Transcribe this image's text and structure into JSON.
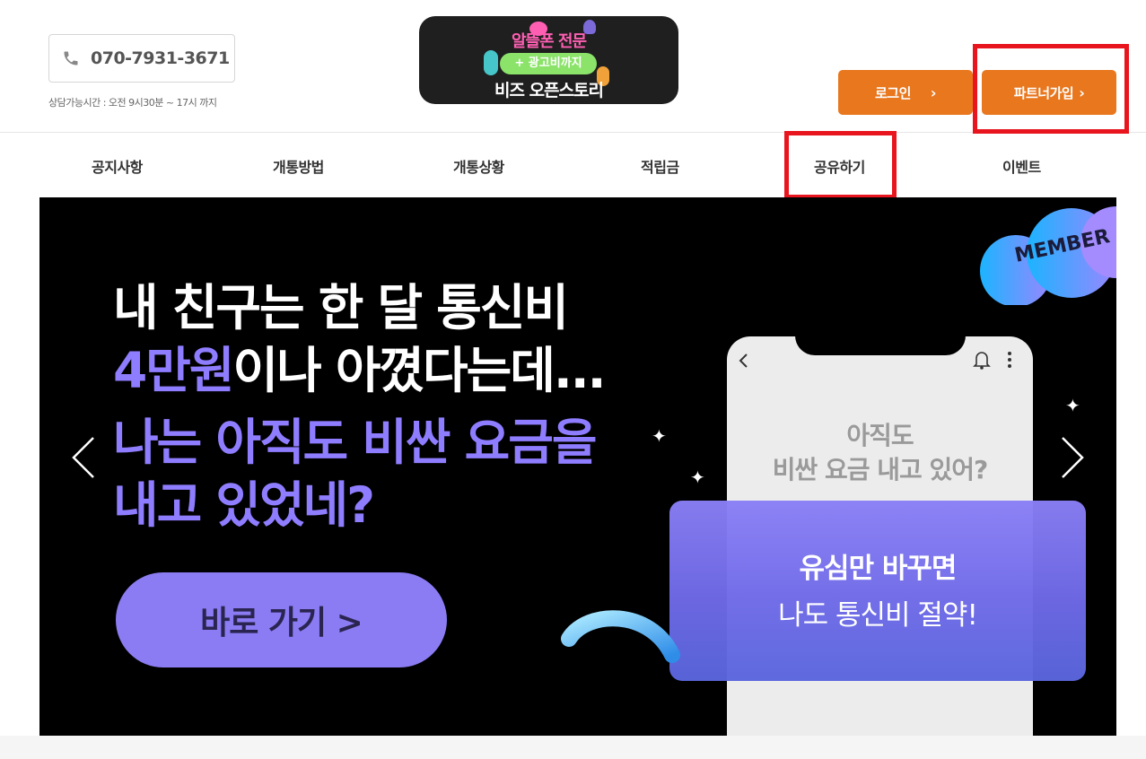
{
  "header": {
    "phone_number": "070-7931-3671",
    "hours": "상담가능시간 : 오전 9시30분 ~ 17시 까지",
    "logo": {
      "line1": "알뜰폰 전문",
      "line2": "+ 광고비까지",
      "line3": "비즈 오픈스토리"
    },
    "login_label": "로그인",
    "partner_label": "파트너가입",
    "chevron": "›"
  },
  "nav": {
    "items": [
      {
        "label": "공지사항"
      },
      {
        "label": "개통방법"
      },
      {
        "label": "개통상황"
      },
      {
        "label": "적립금"
      },
      {
        "label": "공유하기"
      },
      {
        "label": "이벤트"
      }
    ]
  },
  "banner": {
    "line1": "내 친구는 한 달 통신비",
    "line2_highlight": "4만원",
    "line2_rest": "이나 아꼈다는데...",
    "line3": "나는 아직도 비싼 요금을",
    "line4": "내고 있었네?",
    "cta_label": "바로 가기 >",
    "badge": "MEMBER",
    "phone_question_line1": "아직도",
    "phone_question_line2": "비싼 요금 내고 있어?",
    "card_line1": "유심만 바꾸면",
    "card_line2": "나도 통신비 절약!"
  },
  "colors": {
    "accent_orange": "#e8771e",
    "highlight_red": "#e8151e",
    "banner_purple": "#8f7dff",
    "cta_purple": "#8b7cf4"
  },
  "icons": [
    "phone-icon",
    "chevron-left-icon",
    "chevron-right-icon",
    "bell-icon",
    "more-vertical-icon",
    "back-icon",
    "sparkle-icon"
  ]
}
